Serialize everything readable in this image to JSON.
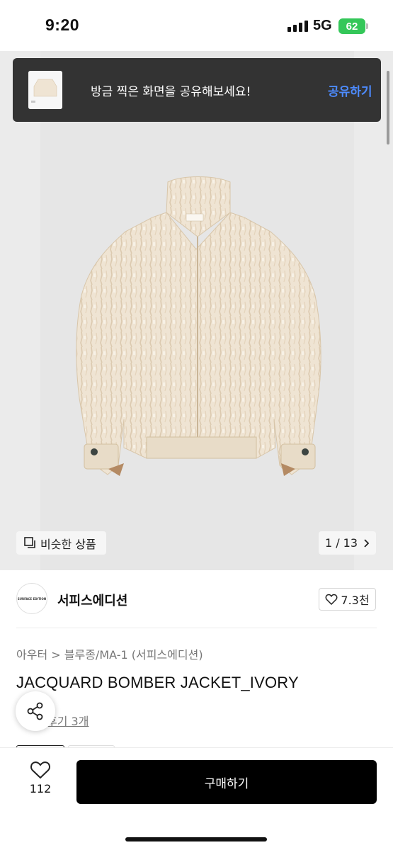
{
  "status_bar": {
    "time": "9:20",
    "network": "5G",
    "battery": "62"
  },
  "toast": {
    "message": "방금 찍은 화면을 공유해보세요!",
    "action_label": "공유하기"
  },
  "gallery": {
    "similar_label": "비슷한 상품",
    "page_current": "1",
    "page_total": "13",
    "page_label": "1 / 13"
  },
  "brand": {
    "logo_text": "SURFACE EDITION",
    "name": "서피스에디션",
    "like_count": "7.3천"
  },
  "product": {
    "breadcrumb": "아우터 > 블루종/MA-1 (서피스에디션)",
    "breadcrumb_category": "아우터",
    "breadcrumb_sub": "블루종/MA-1 (서피스에디션)",
    "title": "JACQUARD BOMBER JACKET_IVORY",
    "review_label": "후기 3개"
  },
  "bottom_bar": {
    "like_count": "112",
    "buy_label": "구매하기"
  },
  "colors": {
    "toast_bg": "#333333",
    "toast_action": "#4d8bff",
    "buy_button": "#000000",
    "battery": "#34c759",
    "jacket": "#efe4d3"
  }
}
